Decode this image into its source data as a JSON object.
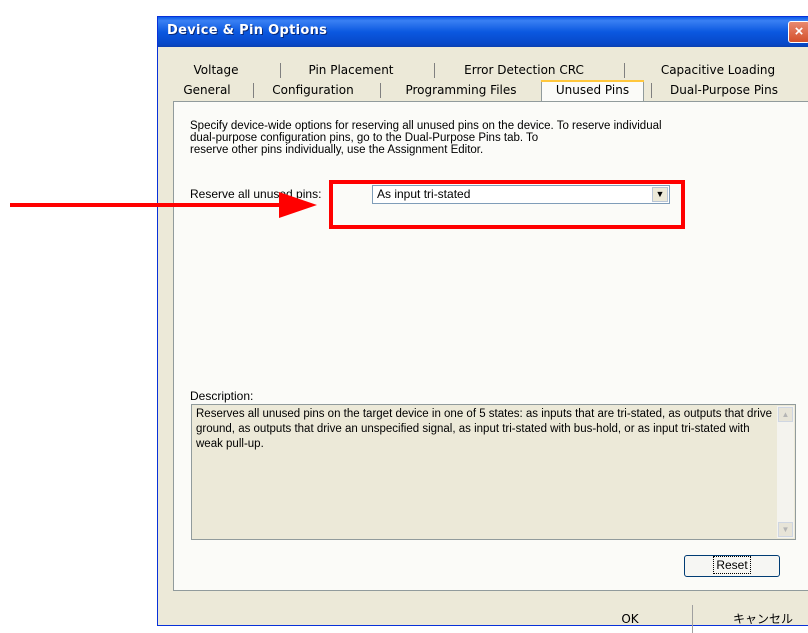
{
  "window": {
    "title": "Device & Pin Options",
    "close_label": "×"
  },
  "tabs": {
    "row1": [
      "Voltage",
      "Pin Placement",
      "Error Detection CRC",
      "Capacitive Loading"
    ],
    "row2": [
      "General",
      "Configuration",
      "Programming Files",
      "Unused Pins",
      "Dual-Purpose Pins"
    ],
    "active": "Unused Pins"
  },
  "panel": {
    "intro_line1": "Specify device-wide options for reserving all unused pins on the device. To reserve individual",
    "intro_line2": "dual-purpose configuration pins, go to the Dual-Purpose Pins tab. To",
    "intro_line3": "reserve other pins individually, use the Assignment Editor.",
    "reserve_label": "Reserve all unused pins:",
    "reserve_value": "As input tri-stated",
    "description_label": "Description:",
    "description_text": "Reserves all unused pins on the target device in one of 5 states: as inputs that are tri-stated, as outputs that drive ground, as outputs that drive an unspecified signal, as input tri-stated with bus-hold, or as input tri-stated with weak pull-up.",
    "reset_label": "Reset"
  },
  "footer": {
    "ok_label": "OK",
    "cancel_label": "キャンセル"
  },
  "annotation": {
    "color": "#ff0000"
  }
}
